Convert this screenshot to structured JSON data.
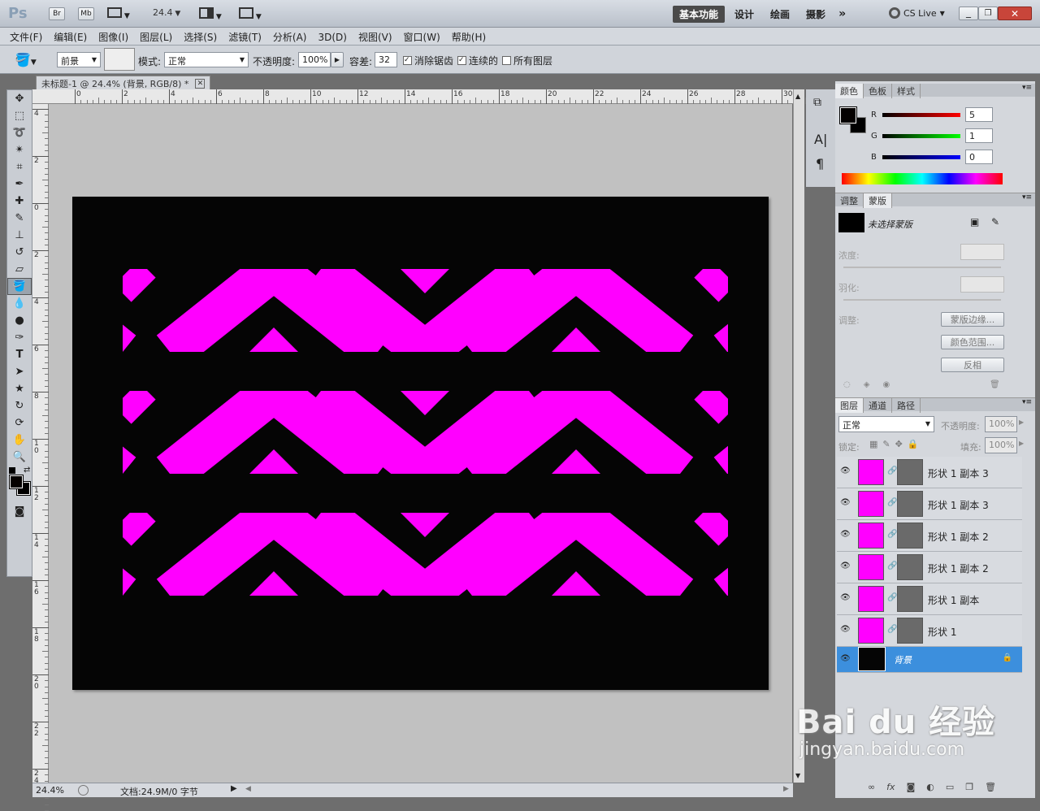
{
  "title_bar": {
    "logo": "Ps",
    "br": "Br",
    "mb": "Mb",
    "zoom": "24.4",
    "workspaces": [
      "基本功能",
      "设计",
      "绘画",
      "摄影"
    ],
    "active_workspace": "基本功能",
    "more": "»",
    "cslive": "CS Live",
    "accent": "#4a4a4a"
  },
  "menu": [
    "文件(F)",
    "编辑(E)",
    "图像(I)",
    "图层(L)",
    "选择(S)",
    "滤镜(T)",
    "分析(A)",
    "3D(D)",
    "视图(V)",
    "窗口(W)",
    "帮助(H)"
  ],
  "options": {
    "fill_label": "前景",
    "mode_label": "模式:",
    "mode_value": "正常",
    "opacity_label": "不透明度:",
    "opacity_value": "100%",
    "tolerance_label": "容差:",
    "tolerance_value": "32",
    "antialias": "消除锯齿",
    "contiguous": "连续的",
    "all_layers": "所有图层"
  },
  "document": {
    "tab_title": "未标题-1 @ 24.4% (背景, RGB/8) *",
    "bg_color": "#050505",
    "shape_color": "#ff00ff"
  },
  "ruler": {
    "h": [
      "0",
      "2",
      "4",
      "6",
      "8",
      "10",
      "12",
      "14",
      "16",
      "18",
      "20",
      "22",
      "24",
      "26",
      "28",
      "30"
    ],
    "v": [
      "4",
      "2",
      "0",
      "2",
      "4",
      "6",
      "8",
      "1 0",
      "1 2",
      "1 4",
      "1 6",
      "1 8",
      "2 0",
      "2 2",
      "2 4"
    ]
  },
  "status": {
    "zoom": "24.4%",
    "doc": "文档:24.9M/0 字节"
  },
  "color_panel": {
    "tabs": [
      "颜色",
      "色板",
      "样式"
    ],
    "r": "5",
    "g": "1",
    "b": "0",
    "r_label": "R",
    "g_label": "G",
    "b_label": "B"
  },
  "masks_panel": {
    "tabs": [
      "调整",
      "蒙版"
    ],
    "status": "未选择蒙版",
    "density": "浓度:",
    "feather": "羽化:",
    "refine": "调整:",
    "btn_edge": "蒙版边缘...",
    "btn_range": "颜色范围...",
    "btn_invert": "反相"
  },
  "layers_panel": {
    "tabs": [
      "图层",
      "通道",
      "路径"
    ],
    "blend": "正常",
    "opacity_label": "不透明度:",
    "opacity_value": "100%",
    "lock_label": "锁定:",
    "fill_label": "填充:",
    "fill_value": "100%",
    "layers": [
      {
        "name": "形状 1 副本 3"
      },
      {
        "name": "形状 1 副本 3"
      },
      {
        "name": "形状 1 副本 2"
      },
      {
        "name": "形状 1 副本 2"
      },
      {
        "name": "形状 1 副本"
      },
      {
        "name": "形状 1"
      },
      {
        "name": "背景",
        "selected": true
      }
    ],
    "selected_color": "#3c8fdd"
  },
  "watermark": {
    "brand": "Bai du 经验",
    "url": "jingyan.baidu.com"
  }
}
